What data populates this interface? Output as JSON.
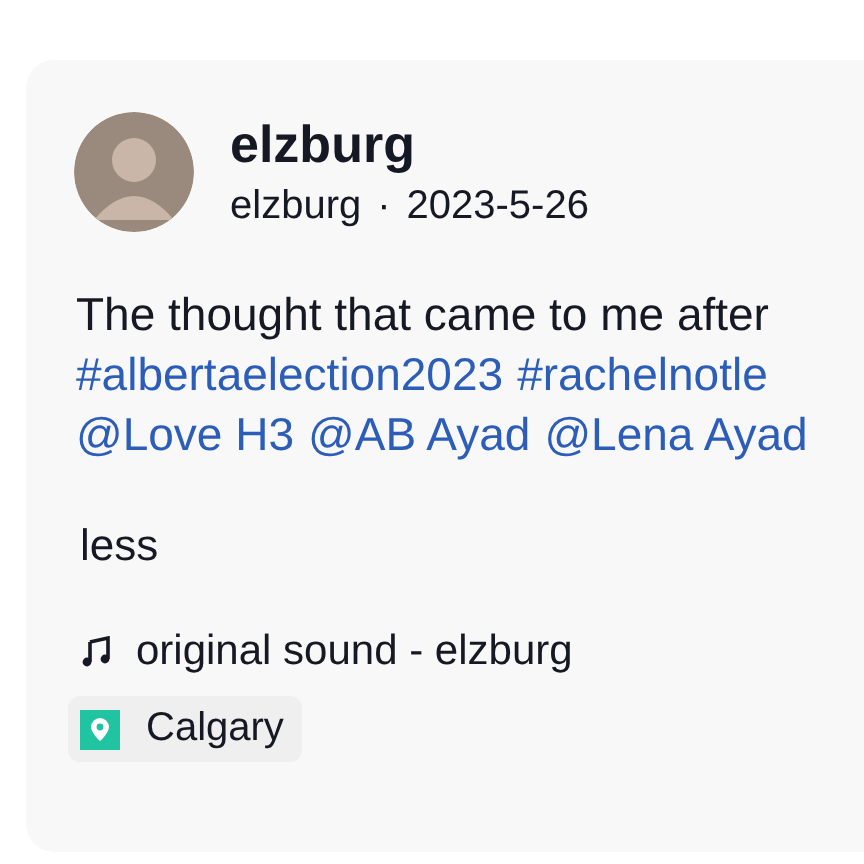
{
  "post": {
    "author": "elzburg",
    "handle": "elzburg",
    "separator": "·",
    "date": "2023-5-26",
    "text": "The thought that came to me after",
    "hashtags": [
      "#albertaelection2023",
      "#rachelnotle"
    ],
    "mentions": [
      "@Love H3",
      "@AB Ayad",
      "@Lena Ayad"
    ],
    "toggle": "less",
    "sound": "original sound - elzburg",
    "location": "Calgary"
  }
}
